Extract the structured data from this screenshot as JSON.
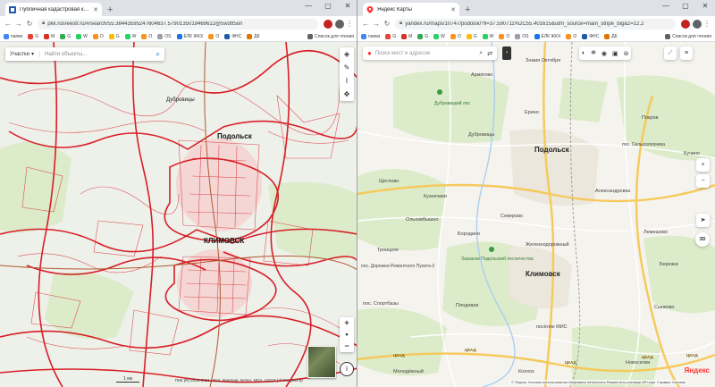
{
  "left_window": {
    "tab_title": "Публичная кадастровая карта",
    "url": "pkk.rosreestr.ru/#/search/55.38443595247604637.5790135019469612@5w3tt5on",
    "bookmarks": [
      "папки",
      "G",
      "M",
      "G",
      "W",
      "O",
      "G",
      "W",
      "O",
      "OS",
      "ЕЛК ЖКХ",
      "O",
      "ФНС",
      "ДК"
    ],
    "bookmarks_right": "Список для чтения",
    "map": {
      "search_mode": "Участки",
      "search_placeholder": "Найти объекты...",
      "place_labels": {
        "dubrovitsy": "Дубровицы",
        "podolsk": "Подольск",
        "klimovsk": "КЛИМОВСК"
      },
      "scale": "1 км",
      "copyright": "ПКК (R) 2010-2021 | Esri, Intermap, NASA, NGA, USGS | © Росреестр"
    }
  },
  "right_window": {
    "tab_title": "Яндекс Карты",
    "url": "yandex.ru/maps/10747/podolsk/?ll=37.590711%2C55.401615&utm_source=main_stripe_big&z=12.2",
    "bookmarks": [
      "папки",
      "G",
      "M",
      "G",
      "W",
      "O",
      "G",
      "W",
      "O",
      "OS",
      "ЕЛК ЖКХ",
      "O",
      "ФНС",
      "ДК"
    ],
    "bookmarks_right": "Список для чтения",
    "map": {
      "search_placeholder": "Поиск мест и адресов",
      "top_label": "Знамя Октября",
      "places": {
        "armanovo": "Армягово",
        "dubrovitsky_les": "Дубровицкий лес",
        "dubrovitsy": "Дубровицы",
        "erino": "Ерино",
        "pokrov": "Покров",
        "podolsk": "Подольск",
        "selkhoz": "пос. Сельхозтехника",
        "kuchino": "Кучино",
        "aleksandrovka": "Александровка",
        "shchegolovo": "Щеглово",
        "kuznechiki": "Кузнечики",
        "olkhovo": "Ольховбышно",
        "severovo": "Северово",
        "borodino": "Бородино",
        "zhelezno": "Железнодорожный",
        "lemeshovo": "Лемешово",
        "troitskoe": "Троицкое",
        "dorozhno": "пос. Дорожно-Ремонтного Пункта-3",
        "zakaznik": "Заказник Подольский лесничества",
        "klimovsk": "Климовск",
        "bereznya": "Березки",
        "sportbazy": "пос. Спортбазы",
        "plodovaya": "Плодовая",
        "pos_mis": "посёлок МИС",
        "sonkovo": "Сынково",
        "molodezhny": "Молодёжный",
        "novoselki": "Новоселки",
        "kolkhoz": "Колхоз"
      },
      "road_labels": [
        "ЦКАД",
        "ЦКАД",
        "ЦКАД",
        "ЦКАД",
        "ЦКАД"
      ],
      "brand": "Яндекс",
      "footer": "© Яндекс   Условия использования   Исправить неточность   Разместить рекламу   API карт   Справка   Условия"
    }
  },
  "colors": {
    "cadastre_line": "#d81f26",
    "cadastre_bg": "#eef0ea",
    "forest": "#dcebc9",
    "yandex_bg": "#f5f3ee",
    "yandex_road_major": "#f6c95a",
    "yandex_road_minor": "#ffffff",
    "yandex_red": "#ff3333"
  }
}
